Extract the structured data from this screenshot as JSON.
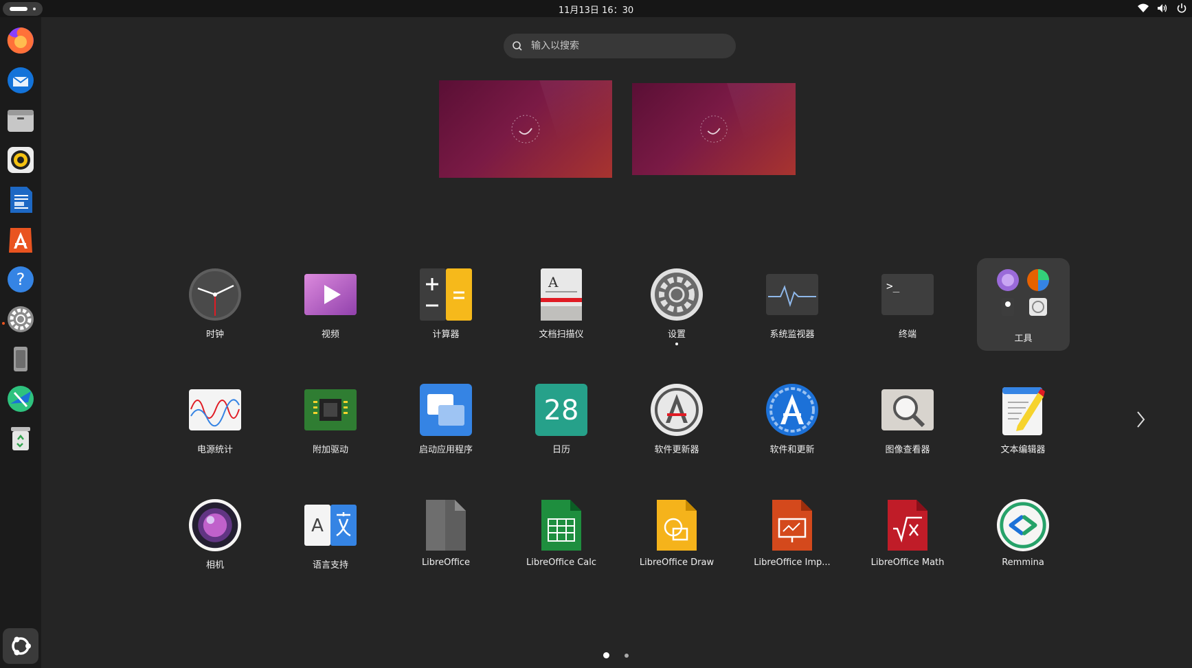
{
  "topbar": {
    "datetime": "11月13日  16：30"
  },
  "search": {
    "placeholder": "输入以搜索"
  },
  "apps": {
    "clock": "时钟",
    "videos": "视频",
    "calculator": "计算器",
    "doc_scanner": "文档扫描仪",
    "settings": "设置",
    "system_monitor": "系统监视器",
    "terminal": "终端",
    "tools_folder": "工具",
    "power_stats": "电源统计",
    "additional_drivers": "附加驱动",
    "startup_apps": "启动应用程序",
    "calendar": "日历",
    "calendar_day": "28",
    "software_updater": "软件更新器",
    "software_updates": "软件和更新",
    "image_viewer": "图像查看器",
    "text_editor": "文本编辑器",
    "camera": "相机",
    "language_support": "语言支持",
    "libreoffice": "LibreOffice",
    "libreoffice_calc": "LibreOffice Calc",
    "libreoffice_draw": "LibreOffice Draw",
    "libreoffice_impress": "LibreOffice Imp...",
    "libreoffice_math": "LibreOffice Math",
    "remmina": "Remmina"
  },
  "terminal_prompt": ">_",
  "text_editor_glyph": "A",
  "colors": {
    "accent": "#e95420",
    "background": "#252525",
    "dock": "#1b1b1b"
  }
}
